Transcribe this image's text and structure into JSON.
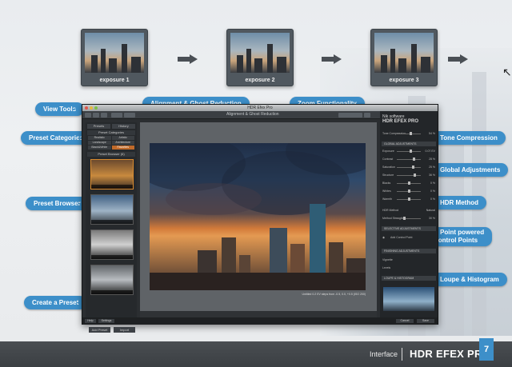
{
  "exposures": [
    {
      "label": "exposure 1"
    },
    {
      "label": "exposure 2"
    },
    {
      "label": "exposure 3"
    }
  ],
  "callouts": {
    "view_tools": "View Tools",
    "alignment": "Alignment & Ghost Reduction",
    "zoom": "Zoom Functionality",
    "preset_categories": "Preset Categories",
    "tone_compression": "Tone Compression",
    "global_adjustments": "Global Adjustments",
    "hdr_method": "HDR Method",
    "upoint_line1": "U Point powered",
    "upoint_line2": "Control Points",
    "preset_browser": "Preset Browser",
    "loupe": "Loupe & Histogram",
    "create_preset": "Create a Preset"
  },
  "app": {
    "title": "HDR Efex Pro",
    "right_brand_top": "Nik software",
    "right_brand": "HDR EFEX PRO",
    "left_tabs": [
      "Presets",
      "History"
    ],
    "categories_header": "Preset Categories",
    "categories": [
      "Realistic",
      "Artistic",
      "Landscape",
      "Architecture",
      "Black&White",
      "Favorites"
    ],
    "selected_category": "Favorites",
    "preset_header": "Preset Browser (6)",
    "left_buttons": [
      "Add Preset",
      "Import"
    ],
    "viewer_title": "Alignment & Ghost Reduction",
    "photo_caption": "Untitled\n0.2 EV steps from -0.5, 0.0, +0.5 (ISO 200)",
    "right_sections": [
      "TONE COMPRESSION",
      "GLOBAL ADJUSTMENTS",
      "HDR METHOD",
      "SELECTIVE ADJUSTMENTS",
      "FINISHING ADJUSTMENTS",
      "LOUPE & HISTOGRAM"
    ],
    "tone_row": {
      "label": "Tone Compression",
      "value": "54 %"
    },
    "global_rows": [
      {
        "label": "Exposure",
        "value": "0.07 EV"
      },
      {
        "label": "Contrast",
        "value": "28 %"
      },
      {
        "label": "Saturation",
        "value": "25 %"
      },
      {
        "label": "Structure",
        "value": "36 %"
      },
      {
        "label": "Blacks",
        "value": "0 %"
      },
      {
        "label": "Whites",
        "value": "0 %"
      },
      {
        "label": "Warmth",
        "value": "0 %"
      }
    ],
    "hdr_method_row": {
      "label": "HDR Method",
      "value": "Natural"
    },
    "method_strength": {
      "label": "Method Strength",
      "value": "30 %"
    },
    "control_point_label": "Add Control Point",
    "vignette_label": "Vignette",
    "levels_label": "Levels",
    "bottom_buttons": [
      "Help",
      "Settings",
      "Cancel",
      "Save"
    ]
  },
  "footer": {
    "section": "Interface",
    "product": "HDR EFEX PRO",
    "page_number": "7"
  }
}
